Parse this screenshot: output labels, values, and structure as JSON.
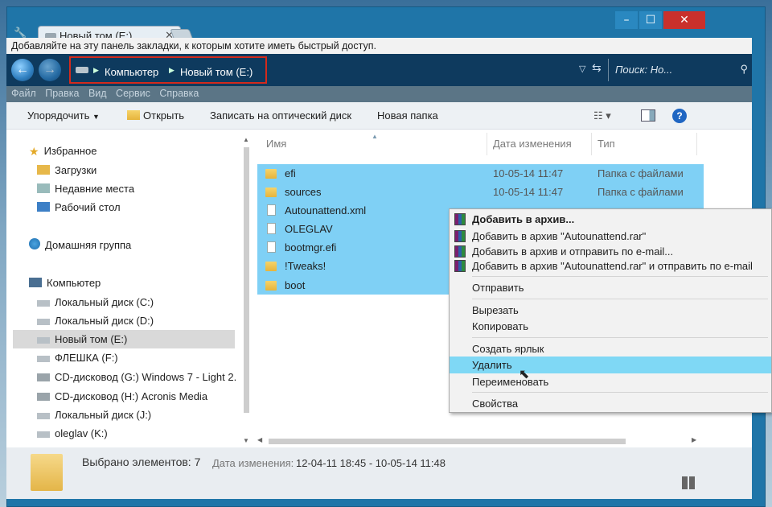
{
  "window": {
    "tab_title": "Новый том (E:)",
    "bookmark_hint": "Добавляйте на эту панель закладки, к которым хотите иметь быстрый доступ."
  },
  "address": {
    "crumbs": [
      "Компьютер",
      "Новый том (E:)"
    ],
    "search_placeholder": "Поиск: Но..."
  },
  "menubar": [
    "Файл",
    "Правка",
    "Вид",
    "Сервис",
    "Справка"
  ],
  "commands": {
    "organize": "Упорядочить",
    "open": "Открыть",
    "burn": "Записать на оптический диск",
    "new_folder": "Новая папка"
  },
  "nav": {
    "favorites": {
      "label": "Избранное",
      "items": [
        "Загрузки",
        "Недавние места",
        "Рабочий стол"
      ]
    },
    "homegroup": "Домашняя группа",
    "computer": {
      "label": "Компьютер",
      "items": [
        "Локальный диск (C:)",
        "Локальный диск (D:)",
        "Новый том (E:)",
        "ФЛЕШКА (F:)",
        "CD-дисковод (G:) Windows 7 - Light 2.",
        "CD-дисковод (H:) Acronis Media",
        "Локальный диск (J:)",
        "oleglav (K:)"
      ]
    },
    "selected_index": 2
  },
  "columns": {
    "name": "Имя",
    "date": "Дата изменения",
    "type": "Тип"
  },
  "files": [
    {
      "name": "efi",
      "date": "10-05-14 11:47",
      "type": "Папка с файлами",
      "icon": "folder-icon"
    },
    {
      "name": "sources",
      "date": "10-05-14 11:47",
      "type": "Папка с файлами",
      "icon": "folder-icon"
    },
    {
      "name": "Autounattend.xml",
      "date": "",
      "type": "",
      "icon": "xml-file-icon"
    },
    {
      "name": "OLEGLAV",
      "date": "",
      "type": "",
      "icon": "file-icon"
    },
    {
      "name": "bootmgr.efi",
      "date": "",
      "type": "",
      "icon": "file-icon"
    },
    {
      "name": "!Tweaks!",
      "date": "",
      "type": "",
      "icon": "folder-icon"
    },
    {
      "name": "boot",
      "date": "",
      "type": "",
      "icon": "folder-icon"
    }
  ],
  "context_menu": {
    "items": [
      "Добавить в архив...",
      "Добавить в архив \"Autounattend.rar\"",
      "Добавить в архив и отправить по e-mail...",
      "Добавить в архив \"Autounattend.rar\" и отправить по e-mail",
      "Отправить",
      "Вырезать",
      "Копировать",
      "Создать ярлык",
      "Удалить",
      "Переименовать",
      "Свойства"
    ],
    "highlighted": "Удалить"
  },
  "status": {
    "selected": "Выбрано элементов: 7",
    "date_label": "Дата изменения:",
    "date_range": "12-04-11 18:45 - 10-05-14 11:48"
  },
  "colors": {
    "selection": "#7fd0f5",
    "titlebar": "#1f75a8",
    "close": "#c9302c",
    "highlight_box": "#d42a1c"
  }
}
